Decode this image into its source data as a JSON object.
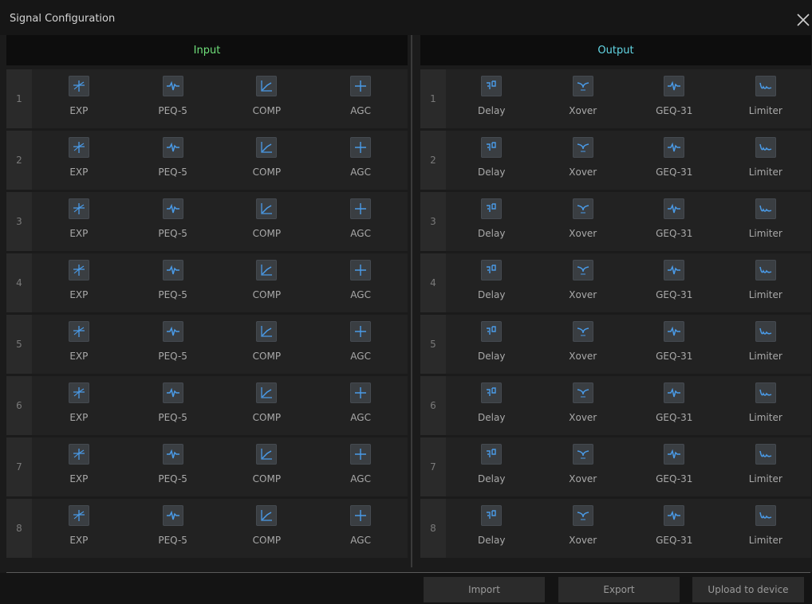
{
  "window": {
    "title": "Signal Configuration",
    "close_icon": "close-icon"
  },
  "input": {
    "header": "Input",
    "header_color": "#6fe07a",
    "modules": [
      {
        "label": "EXP",
        "icon": "expander-icon"
      },
      {
        "label": "PEQ-5",
        "icon": "peq-icon"
      },
      {
        "label": "COMP",
        "icon": "compressor-icon"
      },
      {
        "label": "AGC",
        "icon": "agc-icon"
      }
    ],
    "channels": [
      "1",
      "2",
      "3",
      "4",
      "5",
      "6",
      "7",
      "8"
    ]
  },
  "output": {
    "header": "Output",
    "header_color": "#62d6e4",
    "modules": [
      {
        "label": "Delay",
        "icon": "delay-icon"
      },
      {
        "label": "Xover",
        "icon": "crossover-icon"
      },
      {
        "label": "GEQ-31",
        "icon": "geq-icon"
      },
      {
        "label": "Limiter",
        "icon": "limiter-icon"
      }
    ],
    "channels": [
      "1",
      "2",
      "3",
      "4",
      "5",
      "6",
      "7",
      "8"
    ]
  },
  "footer": {
    "import_label": "Import",
    "export_label": "Export",
    "upload_label": "Upload to device"
  },
  "colors": {
    "icon_accent": "#3d8fe0",
    "background": "#1b1b1b"
  }
}
